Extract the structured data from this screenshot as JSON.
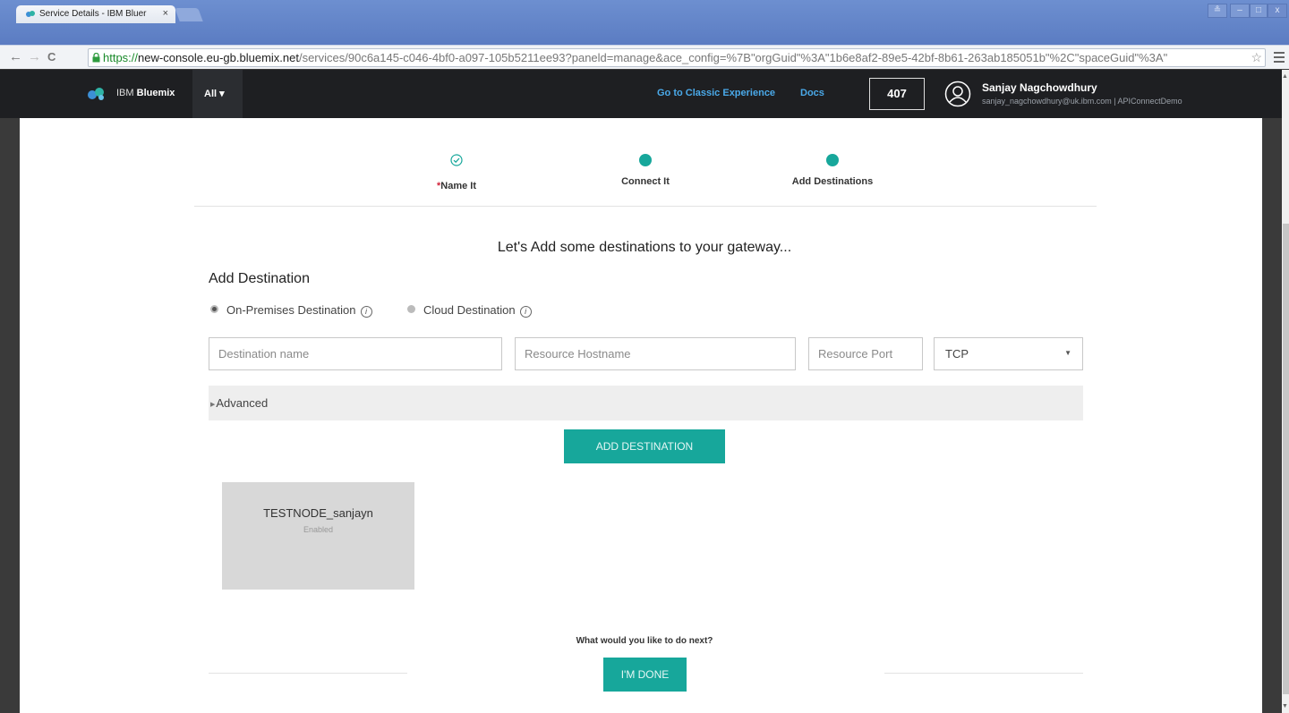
{
  "browser": {
    "tab_title": "Service Details - IBM Bluer",
    "tab_close": "×",
    "url_scheme": "https://",
    "url_host": "new-console.eu-gb.bluemix.net",
    "url_path": "/services/90c6a145-c046-4bf0-a097-105b5211ee93?paneld=manage&ace_config=%7B\"orgGuid\"%3A\"1b6e8af2-89e5-42bf-8b61-263ab185051b\"%2C\"spaceGuid\"%3A\"",
    "back_icon": "←",
    "forward_icon": "→",
    "reload_icon": "C",
    "star_icon": "☆",
    "window_controls": [
      "≗",
      "–",
      "□",
      "x"
    ]
  },
  "header": {
    "brand_prefix": "IBM ",
    "brand_name": "Bluemix",
    "all_menu": "All ▾",
    "classic_link": "Go to Classic Experience",
    "docs_link": "Docs",
    "badge": "407",
    "user_name": "Sanjay Nagchowdhury",
    "user_sub": "sanjay_nagchowdhury@uk.ibm.com | APIConnectDemo"
  },
  "steps": [
    {
      "required_mark": "*",
      "label": "Name It",
      "state": "done"
    },
    {
      "label": "Connect It",
      "state": "current"
    },
    {
      "label": "Add Destinations",
      "state": "current"
    }
  ],
  "main": {
    "intro": "Let's Add some destinations to your gateway...",
    "section_title": "Add Destination",
    "radio_onprem": "On-Premises Destination",
    "radio_cloud": "Cloud Destination",
    "info_glyph": "i",
    "destination_name_placeholder": "Destination name",
    "hostname_placeholder": "Resource Hostname",
    "port_placeholder": "Resource Port",
    "protocol_value": "TCP",
    "advanced_label": "Advanced",
    "add_button": "ADD DESTINATION",
    "card": {
      "name": "TESTNODE_sanjayn",
      "status": "Enabled"
    },
    "next_question": "What would you like to do next?",
    "done_button": "I'M DONE"
  },
  "colors": {
    "accent": "#17a79b",
    "header_bg": "#1e1f22",
    "link": "#4aa9e9"
  }
}
